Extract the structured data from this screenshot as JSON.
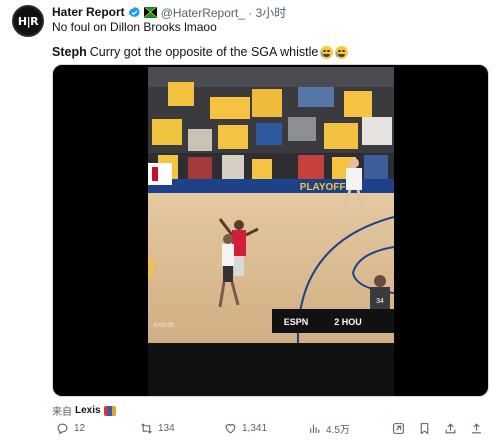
{
  "author": {
    "display_name": "Hater Report",
    "handle_time": "@HaterReport_ · 3小时",
    "avatar_text": "H|R"
  },
  "tweet": {
    "text": "No foul on Dillon Brooks lmaoo"
  },
  "media": {
    "caption_bold": "Steph",
    "caption_rest": "Curry got the opposite of the SGA whistle",
    "scoreboard_team": "2 HOU",
    "scoreboard_network": "ESPN",
    "floor_text": "PLAYOFFS",
    "clock_text": "0:00.00",
    "referee_number": "34"
  },
  "source": {
    "prefix": "来自",
    "name": "Lexis"
  },
  "actions": {
    "replies": "12",
    "retweets": "134",
    "likes": "1,341",
    "views": "4.5万"
  },
  "colors": {
    "brand_blue": "#1d9bf0",
    "text_secondary": "#536471",
    "crowd_gold": "#f5c242"
  },
  "icons": [
    "verified-icon",
    "flag-icon",
    "reply-icon",
    "retweet-icon",
    "like-icon",
    "views-icon",
    "grok-icon",
    "bookmark-icon",
    "share-icon"
  ]
}
